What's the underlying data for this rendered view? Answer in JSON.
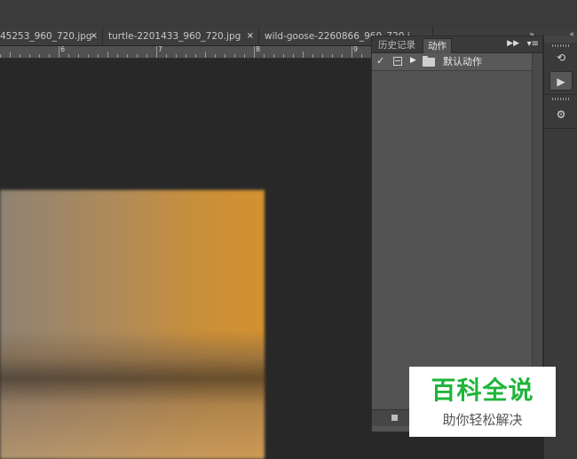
{
  "document_tabs": [
    {
      "label": "45253_960_720.jpg",
      "close": "×"
    },
    {
      "label": "turtle-2201433_960_720.jpg",
      "close": "×"
    },
    {
      "label": "wild-goose-2260866_960_720.j",
      "close": "×"
    }
  ],
  "tab_overflow": "»",
  "ruler": {
    "ticks": [
      "6",
      "7",
      "8",
      "9"
    ]
  },
  "panel": {
    "tabs": [
      {
        "label": "历史记录",
        "active": false
      },
      {
        "label": "动作",
        "active": true
      }
    ],
    "fast_forward_icon": "double-chevron-right-icon",
    "menu_icon": "panel-menu-icon",
    "action_set": {
      "check": "✓",
      "label": "默认动作",
      "icon": "folder-icon"
    },
    "bottom_buttons": [
      "stop-recording-icon"
    ]
  },
  "dock": {
    "collapse": "«",
    "buttons": [
      {
        "name": "history-icon",
        "glyph": "⟲"
      },
      {
        "name": "actions-play-icon",
        "glyph": "▶"
      },
      {
        "name": "properties-icon",
        "glyph": "⚙"
      }
    ]
  },
  "watermark": {
    "title": "百科全说",
    "subtitle": "助你轻松解决",
    "title_color": "#1fb53b"
  },
  "colors": {
    "app_bg": "#282828",
    "panel_bg": "#535353",
    "annotation_arrow": "#e0262b"
  }
}
